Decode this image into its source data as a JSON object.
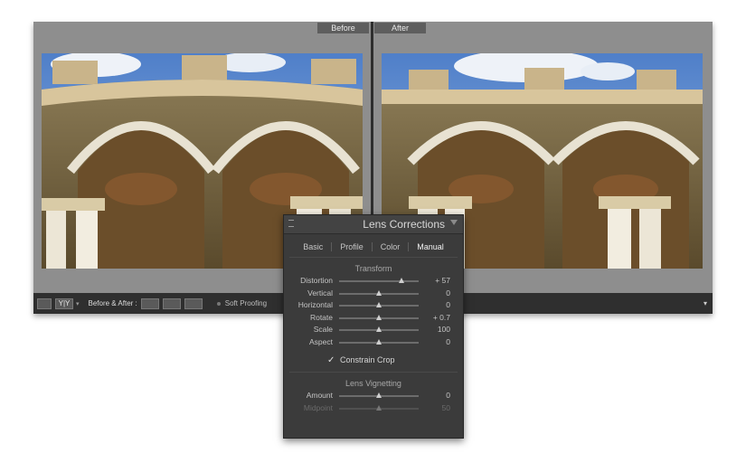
{
  "view_tabs": {
    "before": "Before",
    "after": "After"
  },
  "toolbar": {
    "loupe_icon": "loupe-view-icon",
    "yy_label": "Y|Y",
    "before_after_label": "Before & After :",
    "soft_proofing_label": "Soft Proofing",
    "expand_icon": "chevron-down-icon"
  },
  "panel": {
    "title": "Lens Corrections",
    "tabs": [
      "Basic",
      "Profile",
      "Color",
      "Manual"
    ],
    "active_tab": "Manual",
    "transform": {
      "title": "Transform",
      "sliders": [
        {
          "label": "Distortion",
          "value": "+ 57",
          "pos": 0.785
        },
        {
          "label": "Vertical",
          "value": "0",
          "pos": 0.5
        },
        {
          "label": "Horizontal",
          "value": "0",
          "pos": 0.5
        },
        {
          "label": "Rotate",
          "value": "+ 0.7",
          "pos": 0.5
        },
        {
          "label": "Scale",
          "value": "100",
          "pos": 0.5
        },
        {
          "label": "Aspect",
          "value": "0",
          "pos": 0.5
        }
      ]
    },
    "constrain_crop": {
      "label": "Constrain Crop",
      "checked": true
    },
    "vignetting": {
      "title": "Lens Vignetting",
      "sliders": [
        {
          "label": "Amount",
          "value": "0",
          "pos": 0.5
        },
        {
          "label": "Midpoint",
          "value": "50",
          "pos": 0.5
        }
      ]
    }
  }
}
